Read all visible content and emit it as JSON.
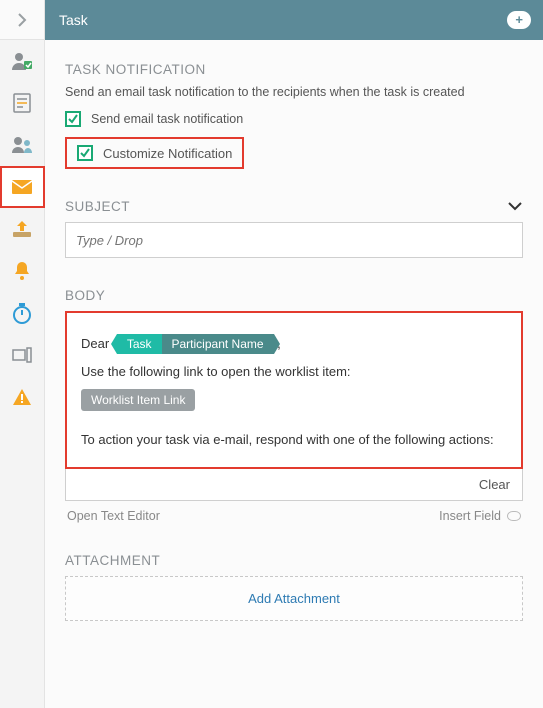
{
  "topbar": {
    "title": "Task",
    "plus": "+"
  },
  "sections": {
    "notification": {
      "title": "TASK NOTIFICATION",
      "desc": "Send an email task notification to the recipients when the task is created",
      "cb_send": "Send email task notification",
      "cb_customize": "Customize Notification"
    },
    "subject": {
      "title": "SUBJECT",
      "placeholder": "Type / Drop"
    },
    "body": {
      "title": "BODY",
      "greeting_prefix": "Dear",
      "chip_task": "Task",
      "chip_participant": "Participant Name",
      "greeting_suffix": ",",
      "line_link_intro": "Use the following link to open the worklist item:",
      "chip_worklist": "Worklist Item Link",
      "line_actions": "To action your task via e-mail, respond with one of the following actions:",
      "clear": "Clear",
      "open_editor": "Open Text Editor",
      "insert_field": "Insert Field"
    },
    "attachment": {
      "title": "ATTACHMENT",
      "add": "Add Attachment"
    }
  }
}
